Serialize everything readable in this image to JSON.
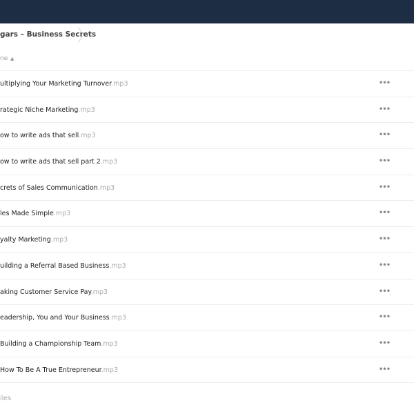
{
  "breadcrumb": {
    "current": "gars – Business Secrets"
  },
  "list_header": {
    "name_label": "ne",
    "sort_indicator": "▲"
  },
  "files": [
    {
      "name": "ultiplying Your Marketing Turnover",
      "ext": ".mp3"
    },
    {
      "name": "rategic Niche Marketing",
      "ext": ".mp3"
    },
    {
      "name": "ow to write ads that sell",
      "ext": ".mp3"
    },
    {
      "name": "ow to write ads that sell part 2",
      "ext": ".mp3"
    },
    {
      "name": "crets of Sales Communication",
      "ext": ".mp3"
    },
    {
      "name": "les Made Simple",
      "ext": ".mp3"
    },
    {
      "name": "yalty Marketing",
      "ext": ".mp3"
    },
    {
      "name": "uilding a Referral Based Business",
      "ext": ".mp3"
    },
    {
      "name": "aking Customer Service Pay",
      "ext": ".mp3"
    },
    {
      "name": "eadership, You and Your Business",
      "ext": ".mp3"
    },
    {
      "name": "Building a Championship Team",
      "ext": ".mp3"
    },
    {
      "name": "How To Be A True Entrepreneur",
      "ext": ".mp3"
    }
  ],
  "row_action_glyph": "•••",
  "summary": "iles",
  "colors": {
    "topbar": "#1d2d44",
    "extension_text": "#a9a9a9"
  }
}
